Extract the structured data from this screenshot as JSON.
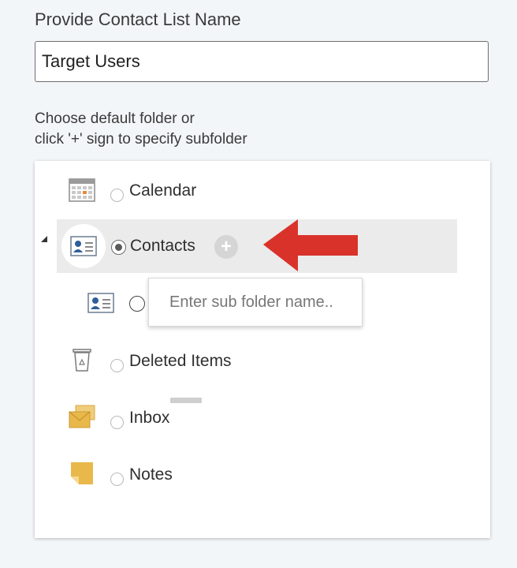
{
  "form": {
    "list_name_label": "Provide Contact List Name",
    "list_name_value": "Target Users",
    "folder_hint_line1": "Choose default folder or",
    "folder_hint_line2": "click '+' sign to specify subfolder"
  },
  "folders": {
    "calendar": "Calendar",
    "contacts": "Contacts",
    "deleted_items": "Deleted Items",
    "inbox": "Inbox",
    "notes": "Notes",
    "plus_label": "+",
    "subfolder_placeholder": "Enter sub folder name..",
    "selected": "Contacts"
  },
  "icons": {
    "calendar": "calendar-icon",
    "contacts": "contact-card-icon",
    "subfolder": "contact-card-icon",
    "deleted_items": "trash-can-icon",
    "inbox": "envelopes-icon",
    "notes": "sticky-note-icon",
    "annotation": "red-arrow-icon"
  },
  "colors": {
    "accent_red": "#d9322b",
    "selected_row": "#ebebeb",
    "contact_blue": "#2f5f9a",
    "folder_yellow": "#e8b84a"
  }
}
